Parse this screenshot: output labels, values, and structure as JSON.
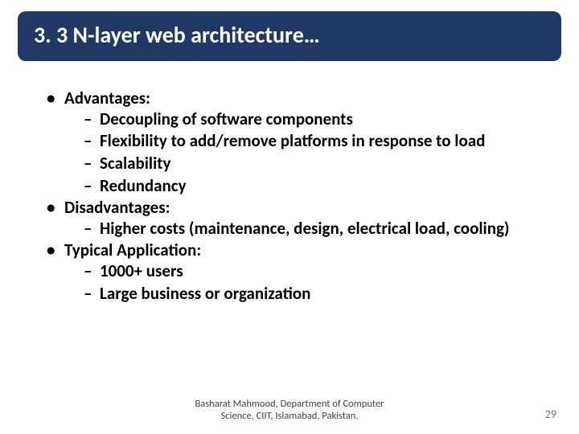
{
  "title": "3. 3 N-layer web architecture…",
  "bullets": [
    {
      "label": "Advantages:",
      "children": [
        "Decoupling of software components",
        "Flexibility to add/remove platforms in response to load",
        "Scalability",
        "Redundancy"
      ]
    },
    {
      "label": "Disadvantages:",
      "children": [
        "Higher costs (maintenance, design, electrical load, cooling)"
      ]
    },
    {
      "label": "Typical Application:",
      "children": [
        "1000+ users",
        "Large business or organization"
      ]
    }
  ],
  "footer": {
    "attribution": "Basharat Mahmood, Department of Computer Science, CIIT, Islamabad, Pakistan.",
    "page_number": "29"
  }
}
